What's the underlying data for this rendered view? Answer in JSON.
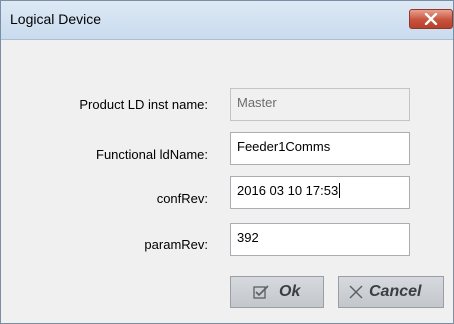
{
  "window": {
    "title": "Logical Device"
  },
  "form": {
    "product_ld_inst_name": {
      "label": "Product LD inst name:",
      "value": "Master"
    },
    "functional_ld_name": {
      "label": "Functional ldName:",
      "value": "Feeder1Comms"
    },
    "conf_rev": {
      "label": "confRev:",
      "value": "2016 03 10 17:53"
    },
    "param_rev": {
      "label": "paramRev:",
      "value": "392"
    }
  },
  "buttons": {
    "ok": "Ok",
    "cancel": "Cancel"
  },
  "colors": {
    "close_button": "#c8523c",
    "title_bar": "#d3e2f2",
    "button_text": "#3a3f45"
  }
}
